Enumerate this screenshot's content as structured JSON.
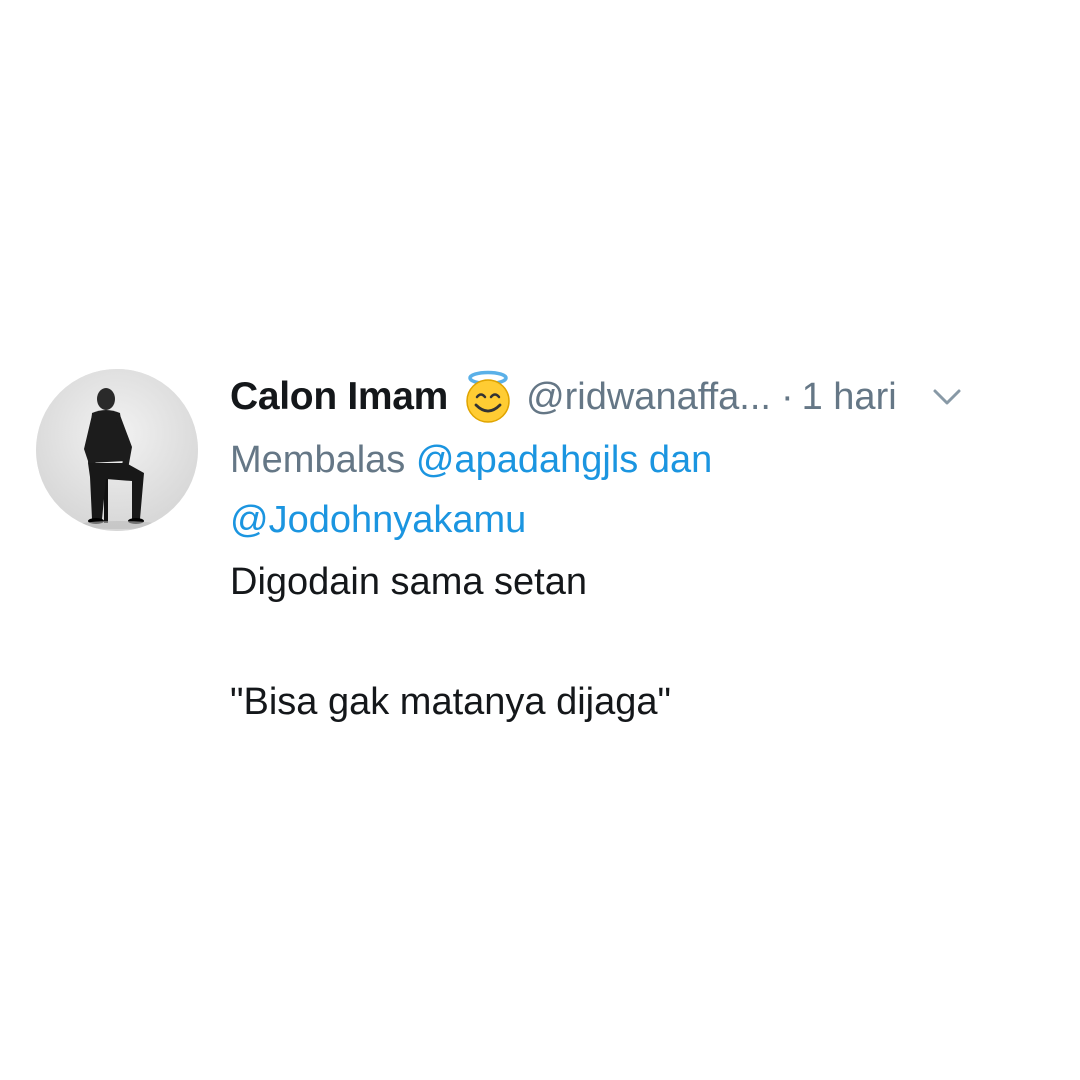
{
  "author": {
    "display_name": "Calon Imam",
    "badge_icon": "smiling-face-with-halo-icon",
    "handle": "@ridwanaffa...",
    "separator": "·",
    "timestamp": "1 hari",
    "avatar_icon": "profile-photo-avatar"
  },
  "reply": {
    "prefix": "Membalas",
    "mention_1": "@apadahgjls",
    "conjunction": "dan",
    "mention_2": "@Jodohnyakamu"
  },
  "body": {
    "line_1": "Digodain sama setan",
    "line_2": "\"Bisa gak matanya dijaga\""
  },
  "menu": {
    "icon": "chevron-down-icon"
  },
  "colors": {
    "text_primary": "#14171a",
    "text_secondary": "#657786",
    "link": "#1b95e0",
    "background": "#ffffff"
  }
}
